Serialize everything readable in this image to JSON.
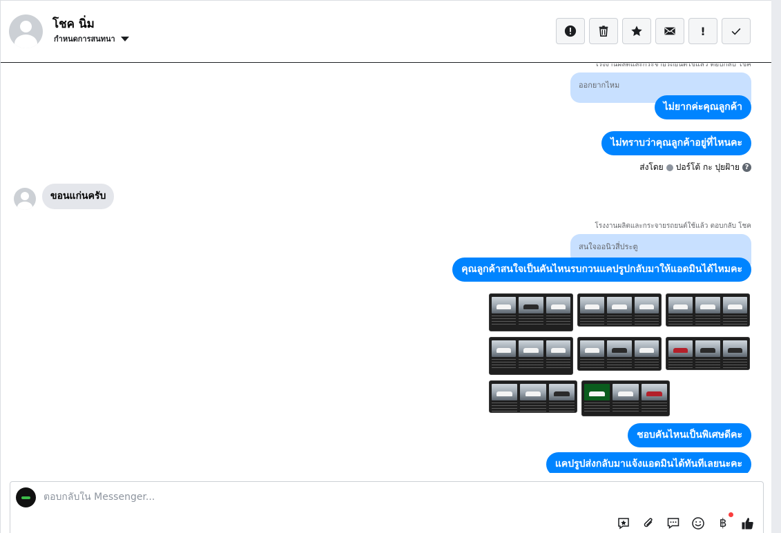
{
  "header": {
    "contact_name": "โชค นิ่ม",
    "assign_label": "กำหนดการสนทนา",
    "toolbar": [
      {
        "name": "spam-button",
        "icon": "exclamation-circle-icon",
        "glyph": "!"
      },
      {
        "name": "delete-button",
        "icon": "trash-icon",
        "glyph": ""
      },
      {
        "name": "star-button",
        "icon": "star-icon",
        "glyph": "★"
      },
      {
        "name": "mark-unread-button",
        "icon": "envelope-icon",
        "glyph": ""
      },
      {
        "name": "follow-up-button",
        "icon": "exclamation-icon",
        "glyph": "!"
      },
      {
        "name": "done-button",
        "icon": "check-icon",
        "glyph": "✓"
      }
    ]
  },
  "messages": {
    "reply_note_1": "โรงงานผลิตและกระจายรถยนต์ใช้แล้ว ตอบกลับ โชค",
    "quoted_1": "ออกยากไหม",
    "out_1": "ไม่ยากค่ะคุณลูกค้า",
    "out_2": "ไม่ทราบว่าคุณลูกค้าอยู่ที่ไหนคะ",
    "sent_by_label": "ส่งโดย",
    "sent_by_name": "ปอร์โต้ กะ ปุยฝ้าย",
    "help_glyph": "?",
    "in_1": "ขอนแก่นครับ",
    "reply_note_2": "โรงงานผลิตและกระจายรถยนต์ใช้แล้ว ตอบกลับ โชค",
    "quoted_2": "สนใจออนิวสี่ประตู",
    "out_3": "คุณลูกค้าสนใจเป็นคันไหนรบกวนแคปรูปกลับมาให้แอดมินได้ไหมคะ",
    "out_4": "ชอบคันไหนเป็นพิเศษดีคะ",
    "out_5": "แคปรูปส่งกลับมาแจ้งแอดมินได้ทันทีเลยนะคะ"
  },
  "composer": {
    "placeholder": "ตอบกลับใน Messenger...",
    "tools": [
      "saved-reply-icon",
      "paperclip-icon",
      "chat-bubble-icon",
      "emoji-icon",
      "baht-payment-icon",
      "thumbs-up-icon"
    ],
    "baht_glyph": "฿"
  },
  "colors": {
    "outgoing_bubble": "#0084ff",
    "quoted_bubble": "#c8e0ff",
    "incoming_bubble": "#e4e6eb",
    "notification_dot": "#fa3e3e"
  }
}
